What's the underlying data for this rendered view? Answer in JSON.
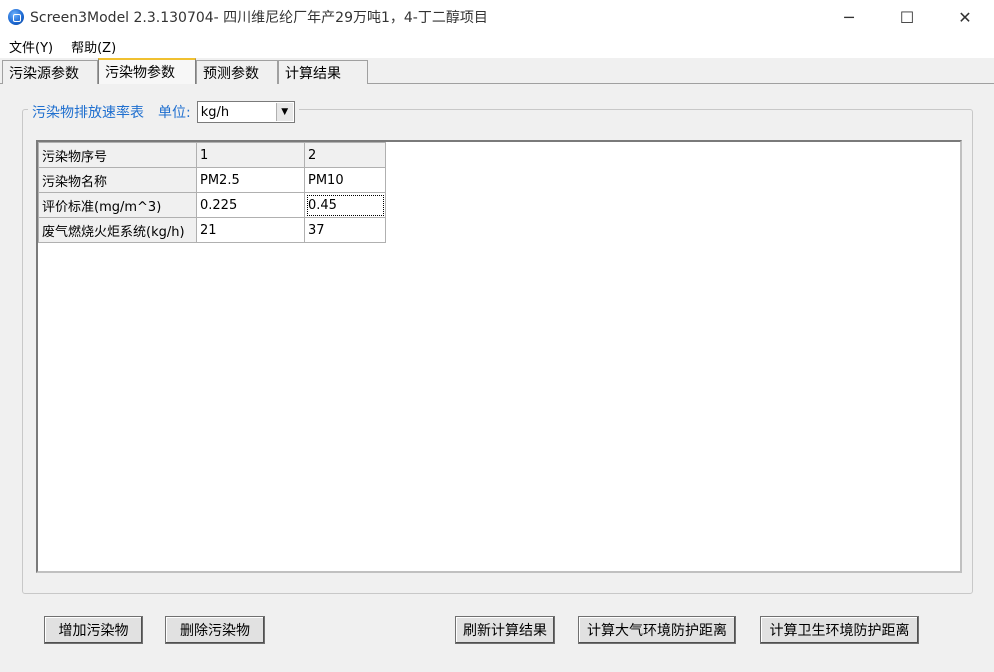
{
  "window": {
    "title": "Screen3Model 2.3.130704- 四川维尼纶厂年产29万吨1，4-丁二醇项目",
    "minimize": "─",
    "maximize": "☐",
    "close": "✕"
  },
  "menu": [
    "文件(Y)",
    "帮助(Z)"
  ],
  "tabs": [
    {
      "label": "污染源参数",
      "active": false
    },
    {
      "label": "污染物参数",
      "active": true
    },
    {
      "label": "预测参数",
      "active": false
    },
    {
      "label": "计算结果",
      "active": false
    }
  ],
  "group": {
    "title": "污染物排放速率表",
    "unit_label": "单位:",
    "unit_value": "kg/h",
    "unit_arrow": "▼"
  },
  "grid": {
    "row_headers": [
      "污染物序号",
      "污染物名称",
      "评价标准(mg/m^3)",
      "废气燃烧火炬系统(kg/h)"
    ],
    "rows": [
      [
        "1",
        "2"
      ],
      [
        "PM2.5",
        "PM10"
      ],
      [
        "0.225",
        "0.45"
      ],
      [
        "21",
        "37"
      ]
    ]
  },
  "buttons": {
    "add": "增加污染物",
    "delete": "删除污染物",
    "refresh": "刷新计算结果",
    "calc_air": "计算大气环境防护距离",
    "calc_health": "计算卫生环境防护距离"
  }
}
